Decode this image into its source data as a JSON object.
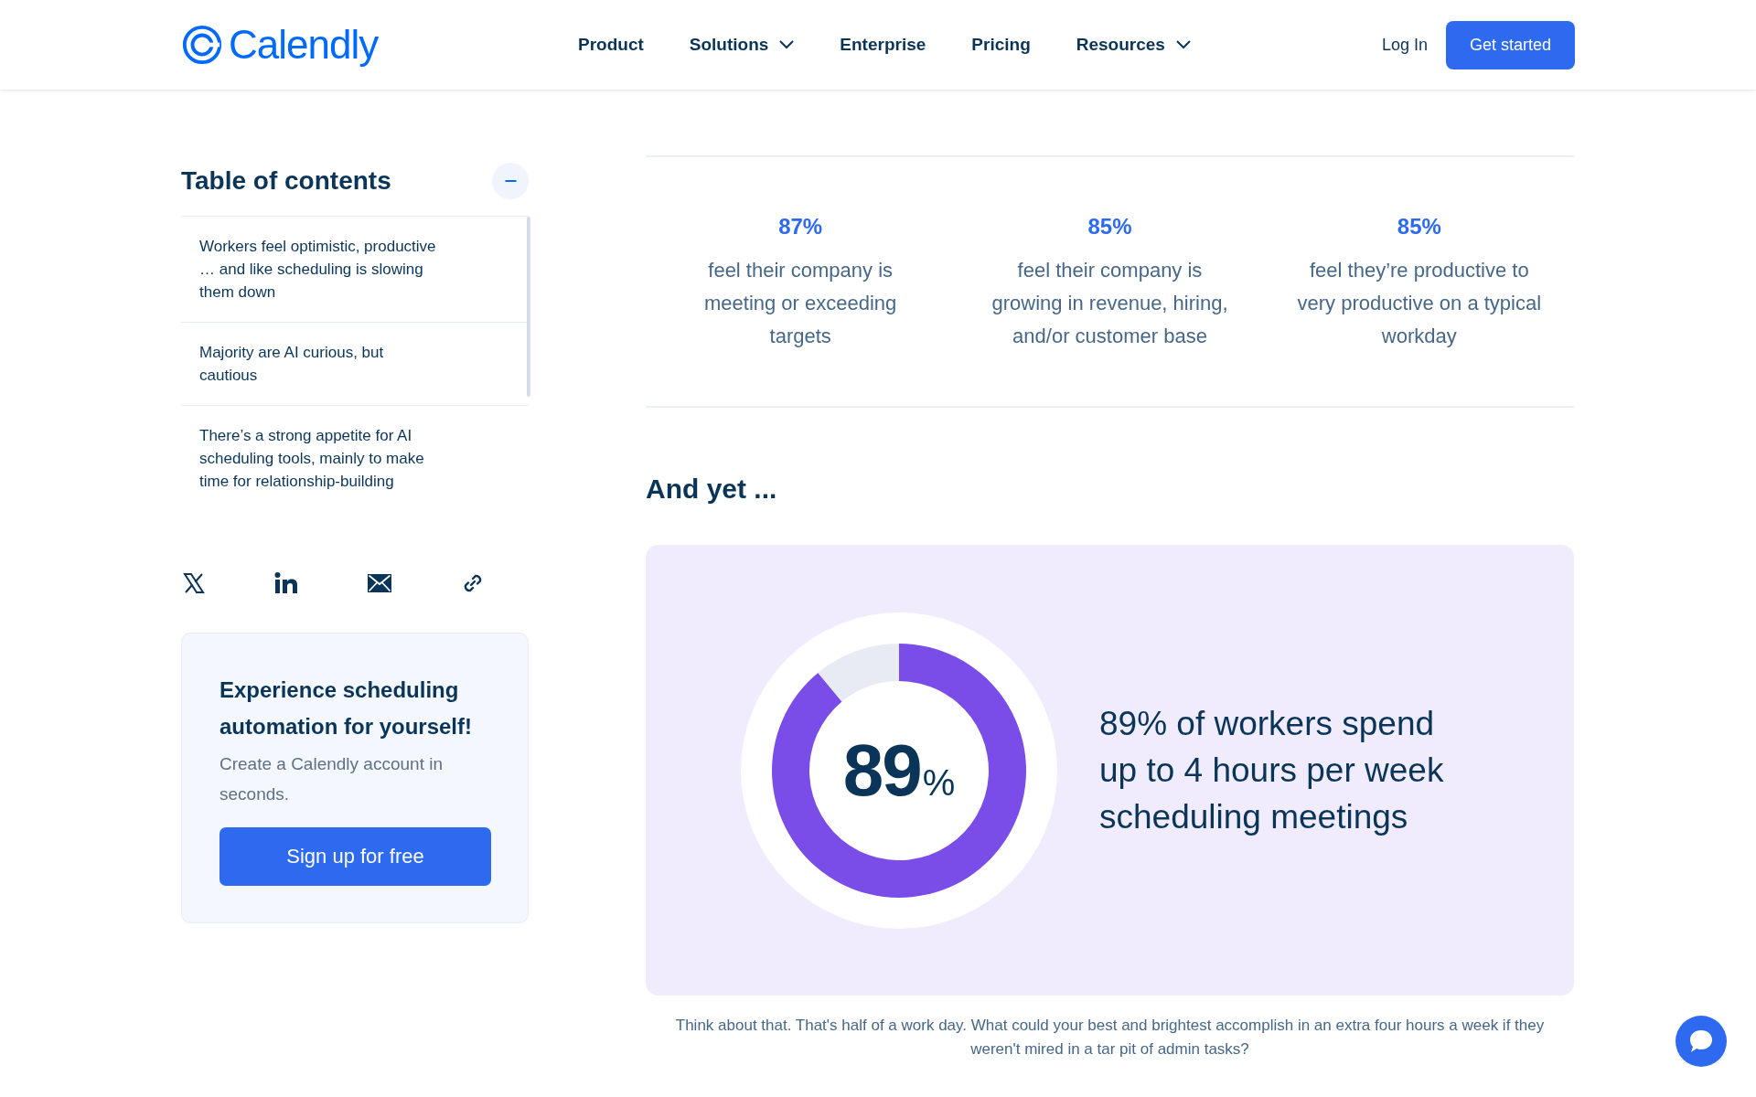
{
  "header": {
    "logo_text": "Calendly",
    "nav": [
      {
        "label": "Product",
        "dropdown": false
      },
      {
        "label": "Solutions",
        "dropdown": true
      },
      {
        "label": "Enterprise",
        "dropdown": false
      },
      {
        "label": "Pricing",
        "dropdown": false
      },
      {
        "label": "Resources",
        "dropdown": true
      }
    ],
    "login": "Log In",
    "cta": "Get started"
  },
  "toc": {
    "title": "Table of contents",
    "expanded": true,
    "items": [
      {
        "text": "Workers feel optimistic, productive … and like scheduling is slowing them down"
      },
      {
        "text": "Majority are AI curious, but cautious"
      },
      {
        "text": "There’s a strong appetite for AI scheduling tools, mainly to make time for relationship-building"
      }
    ]
  },
  "cta_card": {
    "title": "Experience scheduling automation for yourself!",
    "text": "Create a Calendly account in seconds.",
    "button": "Sign up for free"
  },
  "stats": [
    {
      "value": "87%",
      "text": "feel their company is meeting or exceeding targets"
    },
    {
      "value": "85%",
      "text": "feel their company is growing in revenue, hiring, and/or customer base"
    },
    {
      "value": "85%",
      "text": "feel they’re productive to very productive on a typical workday"
    }
  ],
  "section_heading": "And yet ...",
  "highlight": {
    "chart_data": {
      "type": "donut",
      "values": [
        89,
        11
      ]
    },
    "number": "89",
    "unit": "%",
    "text": "89% of workers spend up to 4 hours per week scheduling meetings"
  },
  "caption": "Think about that. That's half of a work day. What could your best and brightest accomplish in an extra four hours a week if they weren't mired in a tar pit of admin tasks?"
}
